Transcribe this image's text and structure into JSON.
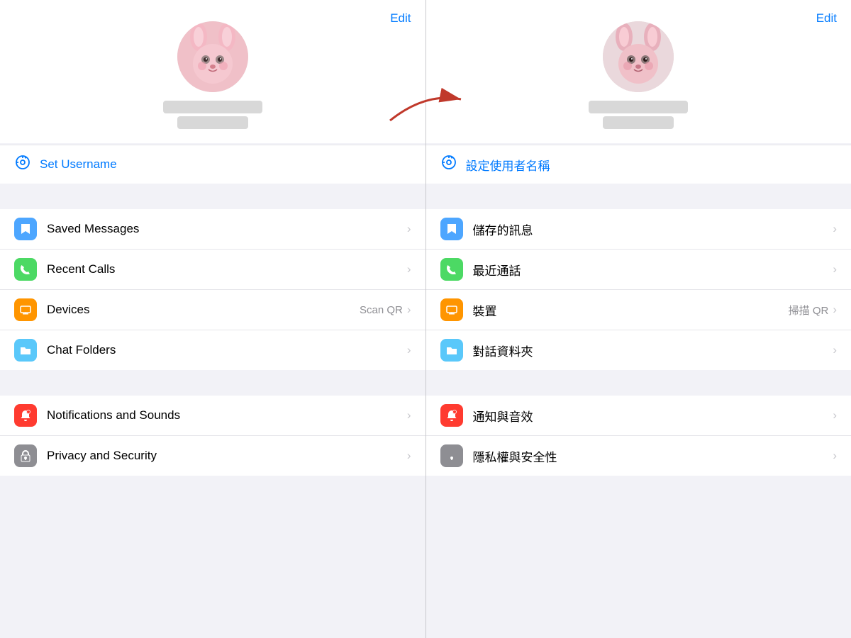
{
  "left_panel": {
    "edit_label": "Edit",
    "username_icon": "⊙",
    "username_label": "Set Username",
    "menu_items": [
      {
        "id": "saved-messages",
        "icon_class": "icon-blue",
        "icon": "🔖",
        "label": "Saved Messages",
        "extra": "",
        "chevron": "›"
      },
      {
        "id": "recent-calls",
        "icon_class": "icon-green",
        "icon": "📞",
        "label": "Recent Calls",
        "extra": "",
        "chevron": "›"
      },
      {
        "id": "devices",
        "icon_class": "icon-orange",
        "icon": "🖥",
        "label": "Devices",
        "extra": "Scan QR",
        "chevron": "›"
      },
      {
        "id": "chat-folders",
        "icon_class": "icon-teal",
        "icon": "📁",
        "label": "Chat Folders",
        "extra": "",
        "chevron": "›"
      }
    ],
    "menu_items2": [
      {
        "id": "notifications",
        "icon_class": "icon-red",
        "icon": "🔔",
        "label": "Notifications and Sounds",
        "extra": "",
        "chevron": "›"
      },
      {
        "id": "privacy",
        "icon_class": "icon-gray",
        "icon": "🔒",
        "label": "Privacy and Security",
        "extra": "",
        "chevron": "›"
      }
    ]
  },
  "right_panel": {
    "edit_label": "Edit",
    "username_icon": "⊙",
    "username_label": "設定使用者名稱",
    "menu_items": [
      {
        "id": "saved-messages-tw",
        "icon_class": "icon-blue",
        "icon": "🔖",
        "label": "儲存的訊息",
        "extra": "",
        "chevron": "›"
      },
      {
        "id": "recent-calls-tw",
        "icon_class": "icon-green",
        "icon": "📞",
        "label": "最近通話",
        "extra": "",
        "chevron": "›"
      },
      {
        "id": "devices-tw",
        "icon_class": "icon-orange",
        "icon": "🖥",
        "label": "裝置",
        "extra": "掃描 QR",
        "chevron": "›"
      },
      {
        "id": "chat-folders-tw",
        "icon_class": "icon-teal",
        "icon": "📁",
        "label": "對話資料夾",
        "extra": "",
        "chevron": "›"
      }
    ],
    "menu_items2": [
      {
        "id": "notifications-tw",
        "icon_class": "icon-red",
        "icon": "🔔",
        "label": "通知與音效",
        "extra": "",
        "chevron": "›"
      },
      {
        "id": "privacy-tw",
        "icon_class": "icon-gray",
        "icon": "🔒",
        "label": "隱私權與安全性",
        "extra": "",
        "chevron": "›"
      }
    ]
  }
}
